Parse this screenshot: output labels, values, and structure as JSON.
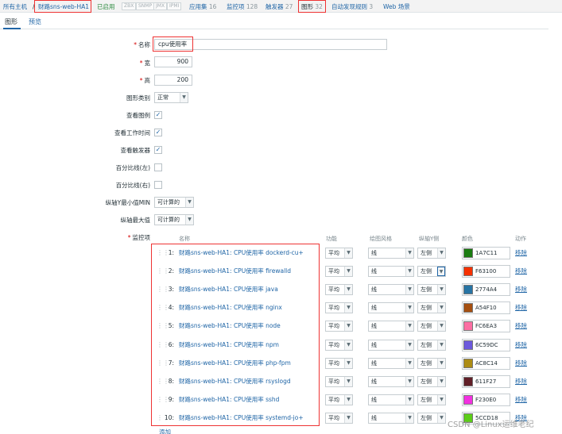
{
  "topnav": {
    "all_hosts": "所有主机",
    "separator": "/",
    "host": "财路sns-web-HA1",
    "enabled": "已启用",
    "availability": [
      "ZBX",
      "SNMP",
      "JMX",
      "IPMI"
    ],
    "applications": {
      "label": "应用集",
      "count": "16"
    },
    "items": {
      "label": "监控项",
      "count": "128"
    },
    "triggers": {
      "label": "触发器",
      "count": "27"
    },
    "graphs": {
      "label": "图形",
      "count": "32"
    },
    "discovery": {
      "label": "自动发现规则",
      "count": "3"
    },
    "web": "Web 场景"
  },
  "tabs": {
    "graph": "图形",
    "preview": "预览"
  },
  "form": {
    "name": {
      "label": "名称",
      "value": "cpu使用率"
    },
    "width": {
      "label": "宽",
      "value": "900"
    },
    "height": {
      "label": "高",
      "value": "200"
    },
    "graph_type": {
      "label": "图形类别",
      "value": "正常"
    },
    "show_legend": {
      "label": "查看图例",
      "checked": true
    },
    "show_working_time": {
      "label": "查看工作时间",
      "checked": true
    },
    "show_triggers": {
      "label": "查看触发器",
      "checked": true
    },
    "percentile_left": {
      "label": "百分比线(左)",
      "checked": false
    },
    "percentile_right": {
      "label": "百分比线(右)",
      "checked": false
    },
    "y_min": {
      "label": "纵轴Y最小值MIN",
      "value": "可计算的"
    },
    "y_max": {
      "label": "纵轴最大值",
      "value": "可计算的"
    },
    "items_label": "监控项"
  },
  "items_table": {
    "headers": {
      "name": "名称",
      "function": "功能",
      "draw_style": "绘图风格",
      "y_axis": "纵轴Y侧",
      "color": "颜色",
      "action": "动作"
    },
    "check_mark": "✓",
    "rows": [
      {
        "num": "1:",
        "name": "财路sns-web-HA1: CPU使用率 dockerd-cu+",
        "function": "平均",
        "style": "线",
        "side": "左侧",
        "color": "1A7C11",
        "remove": "移除"
      },
      {
        "num": "2:",
        "name": "财路sns-web-HA1: CPU使用率 firewalld",
        "function": "平均",
        "style": "线",
        "side": "左侧",
        "color": "F63100",
        "remove": "移除"
      },
      {
        "num": "3:",
        "name": "财路sns-web-HA1: CPU使用率 java",
        "function": "平均",
        "style": "线",
        "side": "左侧",
        "color": "2774A4",
        "remove": "移除"
      },
      {
        "num": "4:",
        "name": "财路sns-web-HA1: CPU使用率 nginx",
        "function": "平均",
        "style": "线",
        "side": "左侧",
        "color": "A54F10",
        "remove": "移除"
      },
      {
        "num": "5:",
        "name": "财路sns-web-HA1: CPU使用率 node",
        "function": "平均",
        "style": "线",
        "side": "左侧",
        "color": "FC6EA3",
        "remove": "移除"
      },
      {
        "num": "6:",
        "name": "财路sns-web-HA1: CPU使用率 npm",
        "function": "平均",
        "style": "线",
        "side": "左侧",
        "color": "6C59DC",
        "remove": "移除"
      },
      {
        "num": "7:",
        "name": "财路sns-web-HA1: CPU使用率 php-fpm",
        "function": "平均",
        "style": "线",
        "side": "左侧",
        "color": "AC8C14",
        "remove": "移除"
      },
      {
        "num": "8:",
        "name": "财路sns-web-HA1: CPU使用率 rsyslogd",
        "function": "平均",
        "style": "线",
        "side": "左侧",
        "color": "611F27",
        "remove": "移除"
      },
      {
        "num": "9:",
        "name": "财路sns-web-HA1: CPU使用率 sshd",
        "function": "平均",
        "style": "线",
        "side": "左侧",
        "color": "F230E0",
        "remove": "移除"
      },
      {
        "num": "10:",
        "name": "财路sns-web-HA1: CPU使用率 systemd-jo+",
        "function": "平均",
        "style": "线",
        "side": "左侧",
        "color": "5CCD18",
        "remove": "移除"
      }
    ],
    "add_link": "添加"
  },
  "watermark": "CSDN @Linux运维老纪"
}
